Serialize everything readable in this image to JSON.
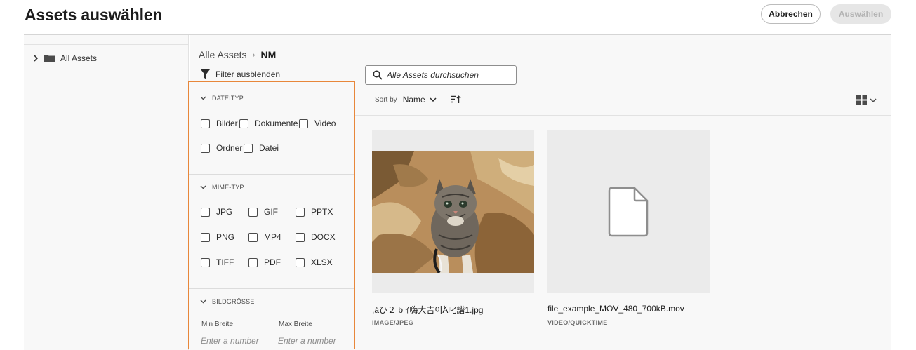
{
  "header": {
    "title": "Assets auswählen",
    "cancel_label": "Abbrechen",
    "select_label": "Auswählen"
  },
  "tree": {
    "root_label": "All Assets"
  },
  "breadcrumb": {
    "root": "Alle Assets",
    "separator": "›",
    "current": "NM"
  },
  "filter_toggle_label": "Filter ausblenden",
  "search": {
    "placeholder": "Alle Assets durchsuchen"
  },
  "sort": {
    "label": "Sort by",
    "value": "Name"
  },
  "filters": {
    "file_type": {
      "title": "DATEITYP",
      "options": [
        "Bilder",
        "Dokumente",
        "Video",
        "Ordner",
        "Datei"
      ]
    },
    "mime_type": {
      "title": "MIME-TYP",
      "options": [
        "JPG",
        "GIF",
        "PPTX",
        "PNG",
        "MP4",
        "DOCX",
        "TIFF",
        "PDF",
        "XLSX"
      ]
    },
    "image_size": {
      "title": "BILDGRÖSSE",
      "min_label": "Min Breite",
      "max_label": "Max Breite",
      "min_placeholder": "Enter a number",
      "max_placeholder": "Enter a number"
    }
  },
  "assets": [
    {
      "name": ",áひ２ b ｲ嗨大吉이Ä叱譜1.jpg",
      "type": "IMAGE/JPEG",
      "icon": "kitten-photo"
    },
    {
      "name": "file_example_MOV_480_700kB.mov",
      "type": "VIDEO/QUICKTIME",
      "icon": "file-icon"
    }
  ],
  "colors": {
    "filter_outline": "#e8873a",
    "panel_bg": "#f8f8f8",
    "thumb_bg": "#ebebeb"
  }
}
